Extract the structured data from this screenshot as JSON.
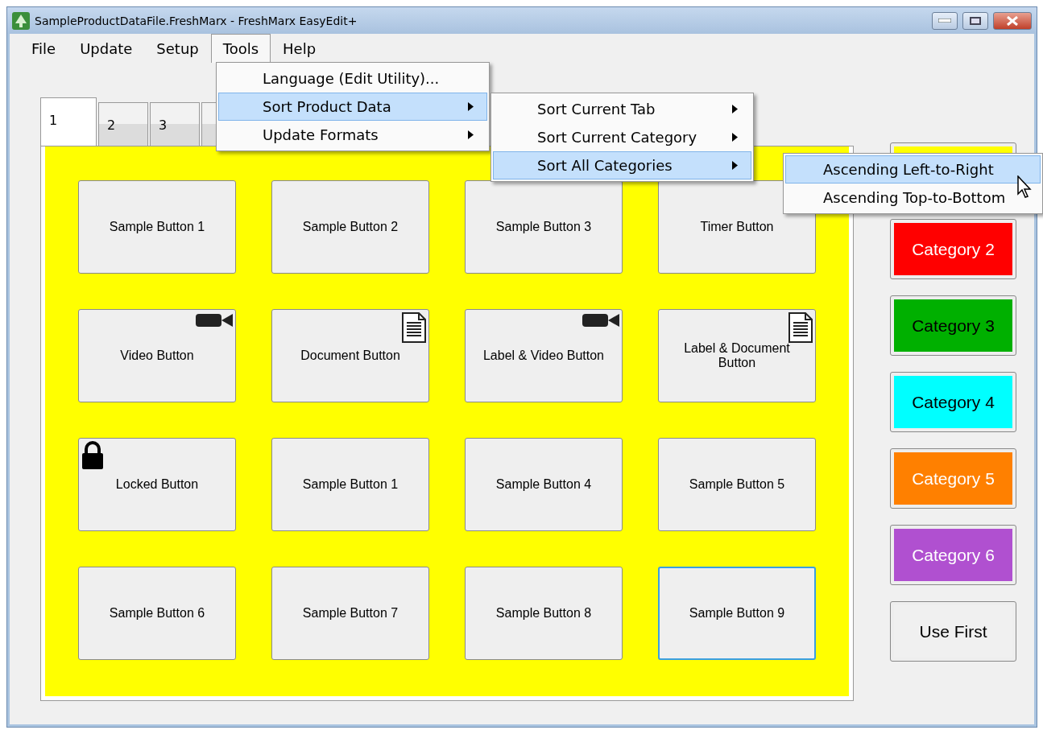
{
  "window": {
    "title": "SampleProductDataFile.FreshMarx - FreshMarx EasyEdit+"
  },
  "menu_bar": [
    {
      "label": "File",
      "selected": false
    },
    {
      "label": "Update",
      "selected": false
    },
    {
      "label": "Setup",
      "selected": false
    },
    {
      "label": "Tools",
      "selected": true
    },
    {
      "label": "Help",
      "selected": false
    }
  ],
  "tabs": [
    {
      "label": "1",
      "selected": true
    },
    {
      "label": "2",
      "selected": false
    },
    {
      "label": "3",
      "selected": false
    },
    {
      "selected": false
    }
  ],
  "grid_buttons": [
    {
      "label": "Sample Button 1",
      "kind": "plain",
      "selected": false
    },
    {
      "label": "Sample Button 2",
      "kind": "plain",
      "selected": false
    },
    {
      "label": "Sample Button 3",
      "kind": "plain",
      "selected": false
    },
    {
      "label": "Timer Button",
      "kind": "plain",
      "selected": false
    },
    {
      "label": "Video Button",
      "kind": "video",
      "selected": false
    },
    {
      "label": "Document Button",
      "kind": "document",
      "selected": false
    },
    {
      "label": "Label & Video Button",
      "kind": "video",
      "selected": false
    },
    {
      "label": "Label & Document Button",
      "kind": "document",
      "selected": false
    },
    {
      "label": "Locked Button",
      "kind": "locked",
      "selected": false
    },
    {
      "label": "Sample Button 1",
      "kind": "plain",
      "selected": false
    },
    {
      "label": "Sample Button 4",
      "kind": "plain",
      "selected": false
    },
    {
      "label": "Sample Button 5",
      "kind": "plain",
      "selected": false
    },
    {
      "label": "Sample Button 6",
      "kind": "plain",
      "selected": false
    },
    {
      "label": "Sample Button 7",
      "kind": "plain",
      "selected": false
    },
    {
      "label": "Sample Button 8",
      "kind": "plain",
      "selected": false
    },
    {
      "label": "Sample Button 9",
      "kind": "plain",
      "selected": true
    }
  ],
  "categories": [
    {
      "color": "#ffff00"
    },
    {
      "label": "Category 2",
      "color": "#ff0000"
    },
    {
      "label": "Category 3",
      "color": "#00b000"
    },
    {
      "label": "Category 4",
      "color": "#00ffff"
    },
    {
      "label": "Category 5",
      "color": "#ff8000"
    },
    {
      "label": "Category 6",
      "color": "#b050d0"
    },
    {
      "label": "Use First",
      "color": "#f0f0f0"
    }
  ],
  "tools_menu": [
    {
      "label": "Language (Edit Utility)...",
      "submenu": false,
      "selected": false
    },
    {
      "label": "Sort Product Data",
      "submenu": true,
      "selected": true
    },
    {
      "label": "Update Formats",
      "submenu": true,
      "selected": false
    }
  ],
  "sort_menu": [
    {
      "label": "Sort Current Tab",
      "submenu": true,
      "selected": false
    },
    {
      "label": "Sort Current Category",
      "submenu": true,
      "selected": false
    },
    {
      "label": "Sort All Categories",
      "submenu": true,
      "selected": true
    }
  ],
  "sort_all_menu": [
    {
      "label": "Ascending Left-to-Right",
      "selected": true
    },
    {
      "label": "Ascending Top-to-Bottom",
      "selected": false
    }
  ]
}
